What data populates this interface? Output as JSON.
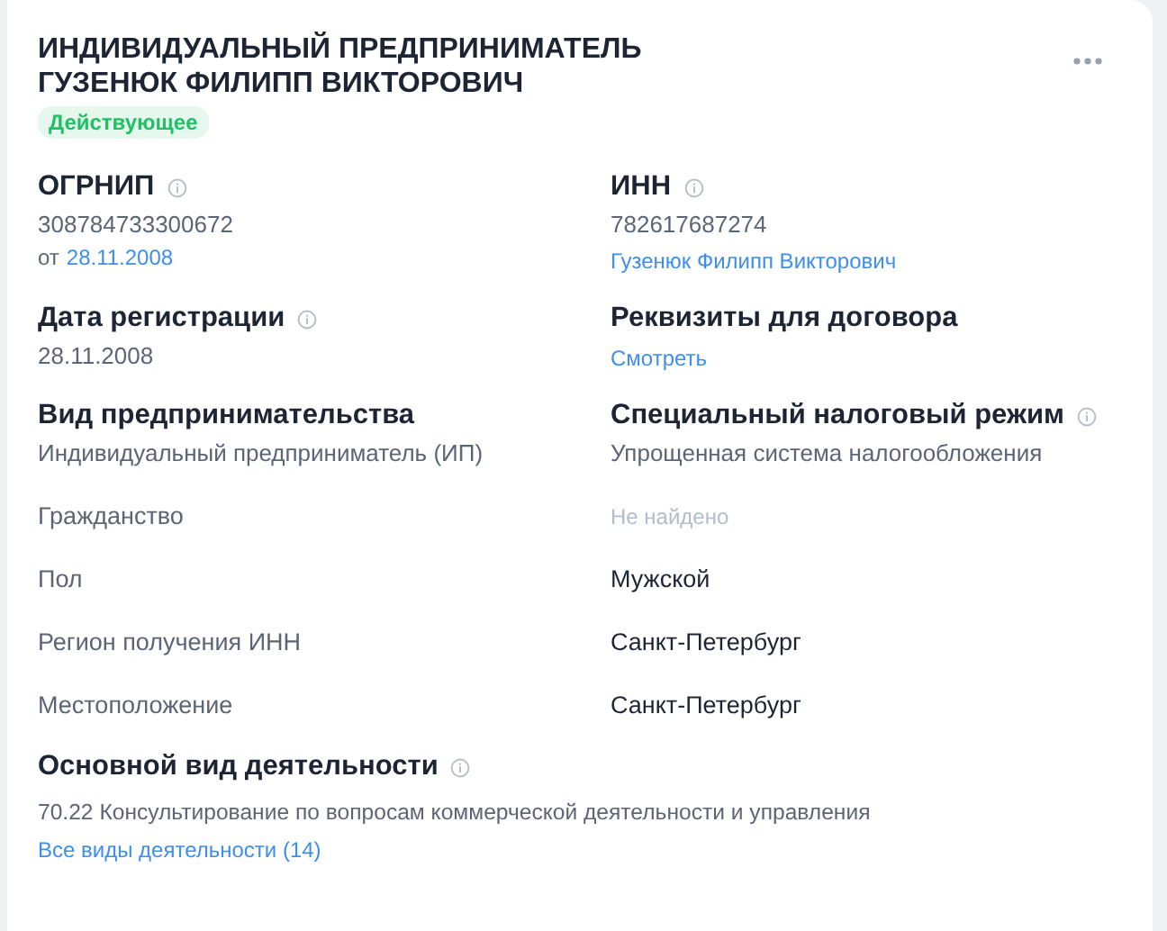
{
  "title_lines": [
    "ИНДИВИДУАЛЬНЫЙ ПРЕДПРИНИМАТЕЛЬ",
    "ГУЗЕНЮК ФИЛИПП ВИКТОРОВИЧ"
  ],
  "status": {
    "label": "Действующее",
    "active": true
  },
  "blocks": [
    {
      "heading": "ОГРНИП",
      "info": true,
      "lines": [
        {
          "kind": "plain",
          "text": "308784733300672"
        },
        {
          "kind": "dated",
          "prefix": "от",
          "link": "28.11.2008"
        }
      ]
    },
    {
      "heading": "ИНН",
      "info": true,
      "lines": [
        {
          "kind": "plain",
          "text": "782617687274"
        },
        {
          "kind": "link",
          "text": "Гузенюк Филипп Викторович"
        }
      ]
    },
    {
      "heading": "Дата регистрации",
      "info": true,
      "lines": [
        {
          "kind": "plain",
          "text": "28.11.2008"
        }
      ]
    },
    {
      "heading": "Реквизиты для договора",
      "info": false,
      "lines": [
        {
          "kind": "link",
          "text": "Смотреть"
        }
      ]
    },
    {
      "heading": "Вид предпринимательства",
      "info": false,
      "lines": [
        {
          "kind": "plain",
          "text": "Индивидуальный предприниматель (ИП)"
        }
      ]
    },
    {
      "heading": "Специальный налоговый режим",
      "info": true,
      "lines": [
        {
          "kind": "plain",
          "text": "Упрощенная система налогообложения"
        }
      ]
    }
  ],
  "details": [
    {
      "label": "Гражданство",
      "value": "Не найдено",
      "muted": true
    },
    {
      "label": "Пол",
      "value": "Мужской",
      "muted": false
    },
    {
      "label": "Регион получения ИНН",
      "value": "Санкт-Петербург",
      "muted": false
    },
    {
      "label": "Местоположение",
      "value": "Санкт-Петербург",
      "muted": false
    }
  ],
  "activity": {
    "heading": "Основной вид деятельности",
    "info": true,
    "text": "70.22 Консультирование по вопросам коммерческой деятельности и управления",
    "link": "Все виды деятельности (14)"
  }
}
